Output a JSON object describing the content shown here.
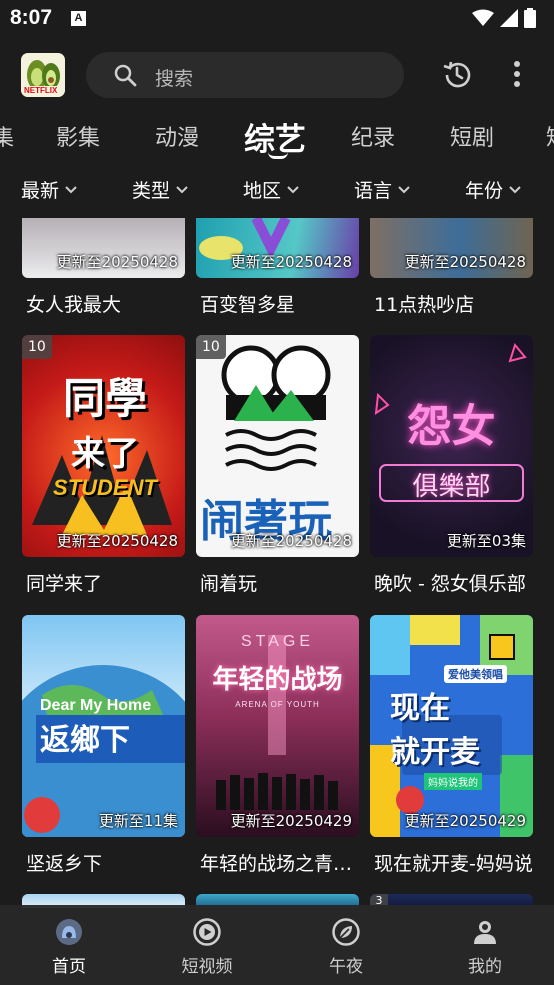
{
  "status_bar": {
    "time": "8:07",
    "notification_icon": "A"
  },
  "header": {
    "logo_text": "NETFLIX",
    "search_placeholder": "搜索",
    "icons": [
      "search-icon",
      "history-icon",
      "more-vert-icon"
    ]
  },
  "category_tabs": [
    {
      "label": "集",
      "active": false
    },
    {
      "label": "影集",
      "active": false
    },
    {
      "label": "动漫",
      "active": false
    },
    {
      "label": "综艺",
      "active": true
    },
    {
      "label": "纪录",
      "active": false
    },
    {
      "label": "短剧",
      "active": false
    },
    {
      "label": "短",
      "active": false
    }
  ],
  "filters": [
    {
      "label": "最新"
    },
    {
      "label": "类型"
    },
    {
      "label": "地区"
    },
    {
      "label": "语言"
    },
    {
      "label": "年份"
    }
  ],
  "shows": [
    {
      "title": "女人我最大",
      "update": "更新至20250428",
      "badge": "",
      "accent": "#e4e0e4"
    },
    {
      "title": "百变智多星",
      "update": "更新至20250428",
      "badge": "",
      "accent": "#35b0b5"
    },
    {
      "title": "11点热吵店",
      "update": "更新至20250428",
      "badge": "",
      "accent": "#3c5a80"
    },
    {
      "title": "同学来了",
      "update": "更新至20250428",
      "badge": "10",
      "accent": "#d8251f"
    },
    {
      "title": "闹着玩",
      "update": "更新至20250428",
      "badge": "10",
      "accent": "#f5f5f5"
    },
    {
      "title": "晚吹 - 怨女俱乐部",
      "update": "更新至03集",
      "badge": "",
      "accent": "#2a1a3c"
    },
    {
      "title": "坚返乡下",
      "update": "更新至11集",
      "badge": "",
      "accent": "#3f88c8"
    },
    {
      "title": "年轻的战场之青春竞演",
      "update": "更新至20250429",
      "badge": "",
      "accent": "#b04470"
    },
    {
      "title": "现在就开麦-妈妈说",
      "update": "更新至20250429",
      "badge": "",
      "accent": "#2f6fd0"
    }
  ],
  "poster_art": {
    "tongxue_line1": "同學",
    "tongxue_line2": "来了",
    "tongxue_line3": "STUDENT",
    "naozhe": "闹著玩",
    "yuannv_line1": "怨女",
    "yuannv_line2": "俱樂部",
    "dear_my_home": "Dear My Home",
    "fanxiang": "返鄉下",
    "stage": "STAGE",
    "nianqing": "年轻的战场",
    "arena": "ARENA OF YOUTH",
    "xianzai_tag": "爱他美领唱",
    "xianzai_line1": "现在",
    "xianzai_line2": "就开麦",
    "xianzai_sub": "妈妈说我的"
  },
  "partial_row_badge": "3",
  "bottom_nav": [
    {
      "label": "首页",
      "icon": "home-icon",
      "active": true
    },
    {
      "label": "短视频",
      "icon": "play-circle-icon",
      "active": false
    },
    {
      "label": "午夜",
      "icon": "leaf-icon",
      "active": false
    },
    {
      "label": "我的",
      "icon": "profile-icon",
      "active": false
    }
  ],
  "colors": {
    "background": "#1c1c1c",
    "search_bg": "#2b2b2b",
    "nav_bg": "#282828"
  }
}
